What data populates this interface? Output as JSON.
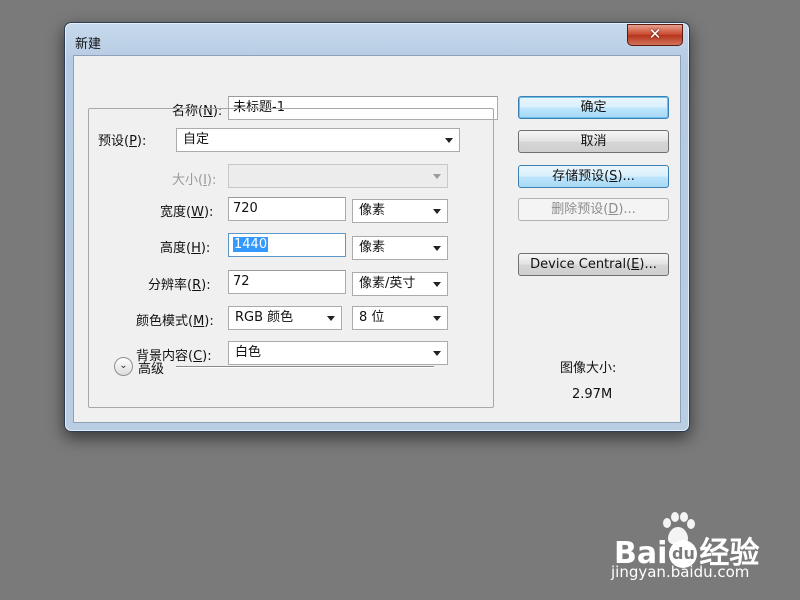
{
  "dialog": {
    "title": "新建",
    "close_glyph": "✕",
    "fields": {
      "name": {
        "label_pre": "名称(",
        "mnemonic": "N",
        "label_post": "):",
        "value": "未标题-1"
      },
      "preset": {
        "label_pre": "预设(",
        "mnemonic": "P",
        "label_post": "):",
        "value": "自定"
      },
      "size": {
        "label_pre": "大小(",
        "mnemonic": "I",
        "label_post": "):",
        "value": ""
      },
      "width": {
        "label_pre": "宽度(",
        "mnemonic": "W",
        "label_post": "):",
        "value": "720",
        "unit": "像素"
      },
      "height": {
        "label_pre": "高度(",
        "mnemonic": "H",
        "label_post": "):",
        "value": "1440",
        "unit": "像素"
      },
      "resolution": {
        "label_pre": "分辨率(",
        "mnemonic": "R",
        "label_post": "):",
        "value": "72",
        "unit": "像素/英寸"
      },
      "color_mode": {
        "label_pre": "颜色模式(",
        "mnemonic": "M",
        "label_post": "):",
        "value": "RGB 颜色",
        "bits": "8 位"
      },
      "background": {
        "label_pre": "背景内容(",
        "mnemonic": "C",
        "label_post": "):",
        "value": "白色"
      }
    },
    "advanced_label": "高级",
    "advanced_icon": "chevron-double-down-icon",
    "buttons": {
      "ok": "确定",
      "cancel": "取消",
      "save_preset": {
        "pre": "存储预设(",
        "mnemonic": "S",
        "post": ")..."
      },
      "delete_preset": {
        "pre": "删除预设(",
        "mnemonic": "D",
        "post": ")..."
      },
      "device_central": {
        "pre": "Device Central(",
        "mnemonic": "E",
        "post": ")..."
      }
    },
    "image_size_label": "图像大小:",
    "image_size_value": "2.97M"
  },
  "watermark": {
    "brand_left": "Bai",
    "brand_right": "经验",
    "brand_du": "du",
    "url": "jingyan.baidu.com",
    "icon": "baidu-paw-icon"
  },
  "colors": {
    "background": "#7a7a7a",
    "selection": "#3399ff",
    "close_button": "#c7462c"
  }
}
